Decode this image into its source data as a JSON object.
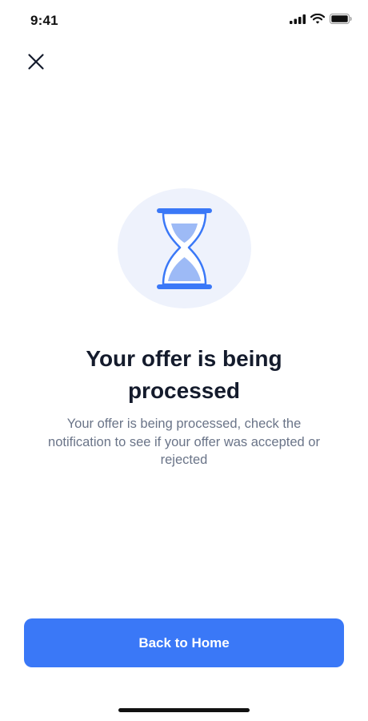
{
  "status_bar": {
    "time": "9:41",
    "icons": [
      "signal-icon",
      "wifi-icon",
      "battery-icon"
    ]
  },
  "header": {
    "close_icon": "close-icon"
  },
  "illustration": {
    "icon": "hourglass-icon",
    "colors": {
      "circle_background": "#eef2fc",
      "accent": "#3a78f7",
      "sand": "#9dbaf6"
    }
  },
  "content": {
    "title": "Your offer is being processed",
    "message": "Your offer is being processed, check the notification to see if your offer was accepted or rejected"
  },
  "actions": {
    "primary_label": "Back to Home",
    "primary_color": "#3a78f7"
  }
}
